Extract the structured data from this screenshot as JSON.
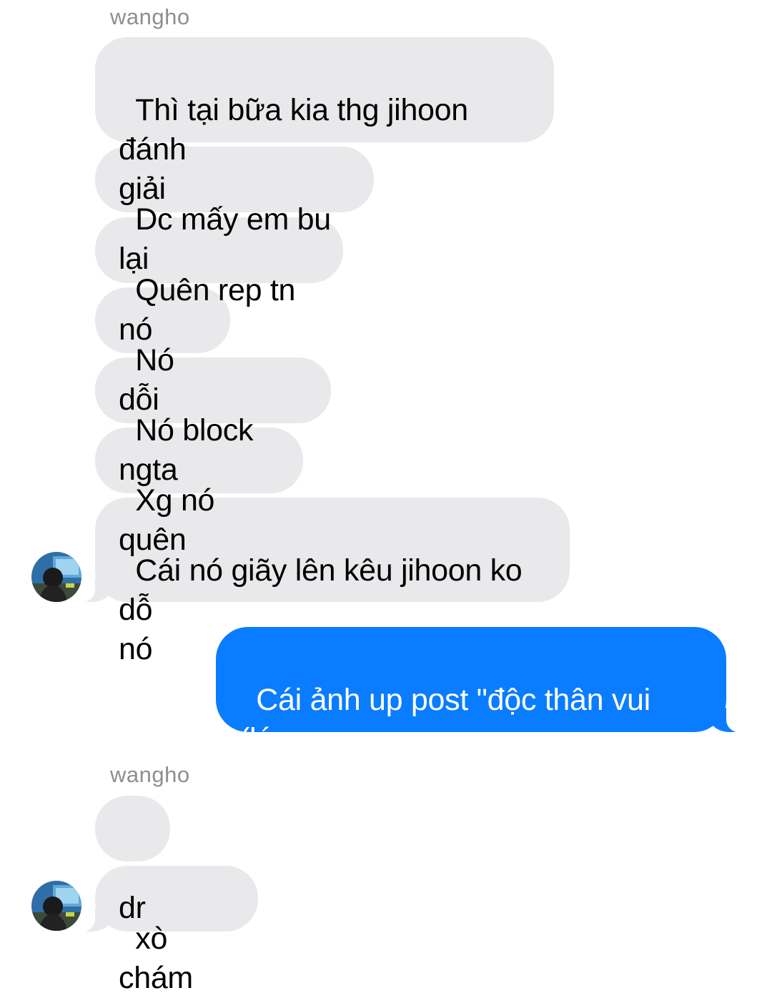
{
  "thread": {
    "sender_name_1": "wangho",
    "sender_name_2": "wangho",
    "messages": [
      {
        "text": "Thì tại bữa kia thg jihoon đánh\ngiải"
      },
      {
        "text": "Dc mấy em bu lại"
      },
      {
        "text": "Quên rep tn nó"
      },
      {
        "text": "Nó dỗi"
      },
      {
        "text": "Nó block ngta"
      },
      {
        "text": "Xg nó quên"
      },
      {
        "text": "Cái nó giãy lên kêu jihoon ko dỗ\nnó"
      },
      {
        "text": "Cái ảnh up post \"độc thân vui (lúc\nko) tính\" hả"
      },
      {
        "text": "dr"
      },
      {
        "text": "xò chám"
      }
    ]
  },
  "colors": {
    "incoming_bubble": "#e9e9eb",
    "outgoing_bubble": "#0a7cff",
    "sender_label": "#8e8e93"
  },
  "icons": {
    "avatar": "contact-avatar-photo"
  }
}
